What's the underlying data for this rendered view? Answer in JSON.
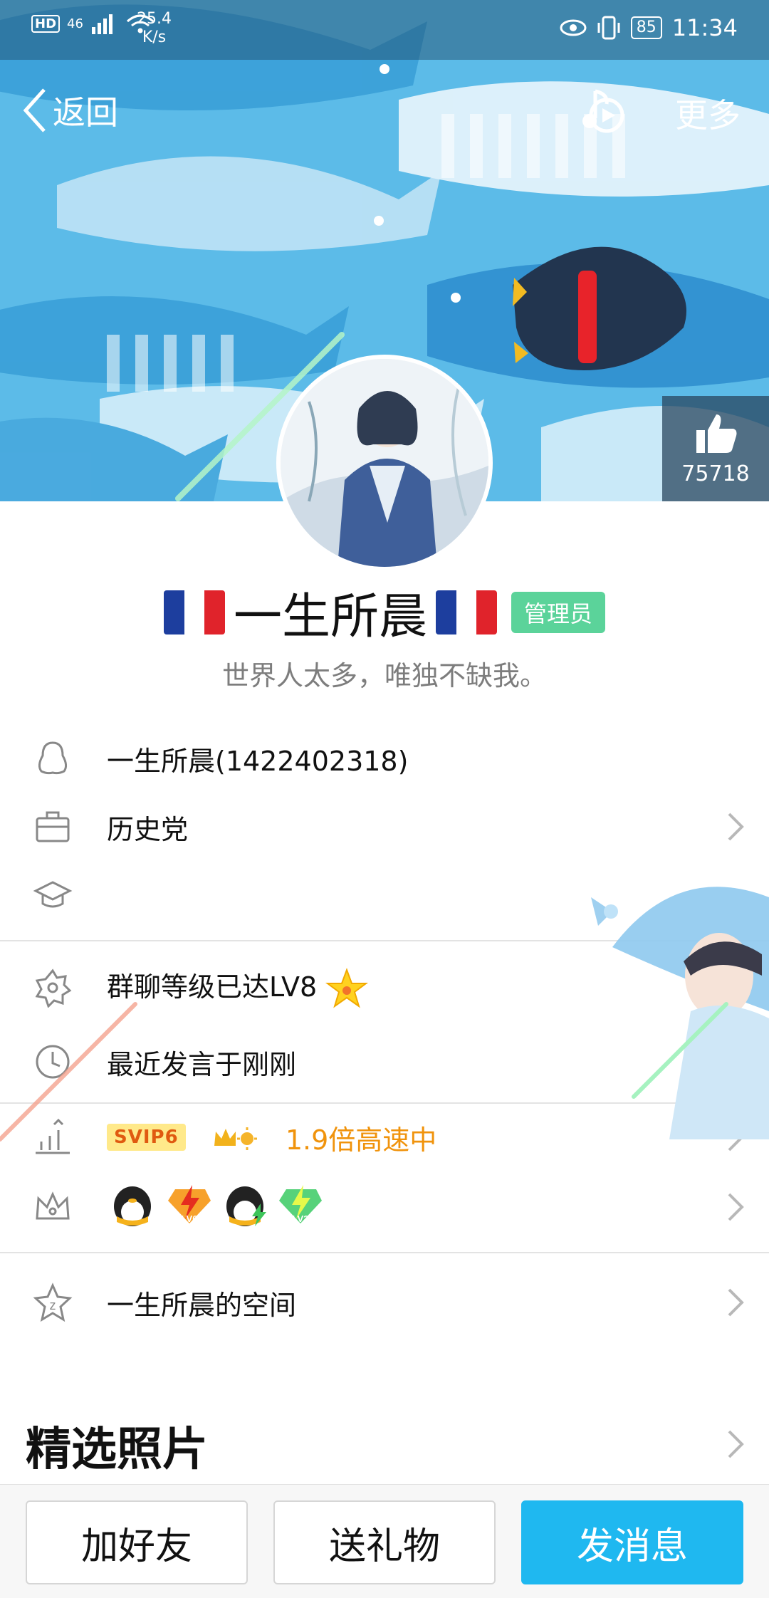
{
  "status_bar": {
    "hd": "HD",
    "network_type": "46",
    "speed_value": "25.4",
    "speed_unit": "K/s",
    "battery": "85",
    "time": "11:34"
  },
  "nav": {
    "back_label": "返回",
    "more_label": "更多"
  },
  "like": {
    "count": "75718"
  },
  "profile": {
    "nickname": "一生所晨",
    "admin_badge": "管理员",
    "signature": "世界人太多，唯独不缺我。"
  },
  "info": {
    "account": "一生所晨(1422402318)",
    "occupation": "历史党",
    "education": "",
    "group_level": "群聊等级已达LV8",
    "last_speak": "最近发言于刚刚",
    "vip_badge": "SVIP6",
    "vip_speed": "1.9倍高速中",
    "space": "一生所晨的空间"
  },
  "photos": {
    "section_title": "精选照片"
  },
  "bottom_bar": {
    "add_friend": "加好友",
    "send_gift": "送礼物",
    "send_message": "发消息"
  },
  "colors": {
    "banner_blue": "#4fb1e4",
    "primary": "#1fb8f0",
    "admin_green": "#5bd39a",
    "vip_orange": "#f0930c"
  }
}
